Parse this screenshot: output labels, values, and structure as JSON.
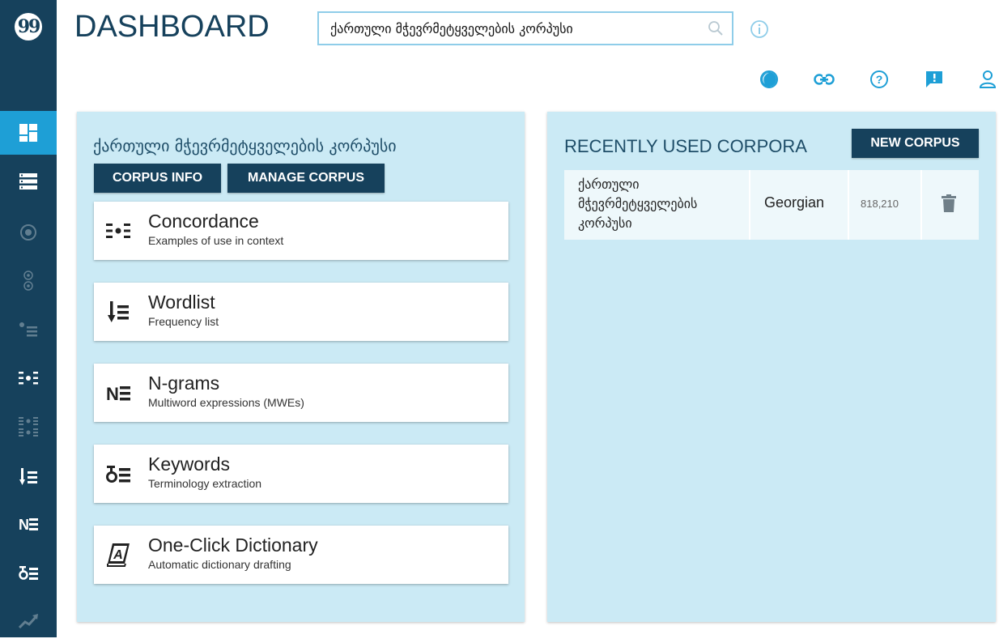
{
  "header": {
    "title": "DASHBOARD",
    "search": {
      "value": "ქართული მჭევრმეტყველების კორპუსი",
      "placeholder": ""
    }
  },
  "sidebar": {
    "items": [
      {
        "icon": "dashboard-icon",
        "active": true
      },
      {
        "icon": "corpus-list-icon"
      },
      {
        "icon": "target-icon",
        "dim": true
      },
      {
        "icon": "two-circles-icon",
        "dim": true
      },
      {
        "icon": "dot-list-icon",
        "dim": true
      },
      {
        "icon": "concordance-icon"
      },
      {
        "icon": "parallel-concordance-icon",
        "dim": true
      },
      {
        "icon": "wordlist-icon"
      },
      {
        "icon": "ngrams-icon"
      },
      {
        "icon": "keywords-icon"
      },
      {
        "icon": "trends-icon",
        "dim": true
      }
    ]
  },
  "left_panel": {
    "corpus_name": "ქართული მჭევრმეტყველების კორპუსი",
    "corpus_info_label": "CORPUS INFO",
    "manage_corpus_label": "MANAGE CORPUS",
    "tools": [
      {
        "title": "Concordance",
        "subtitle": "Examples of use in context",
        "icon": "concordance-icon"
      },
      {
        "title": "Wordlist",
        "subtitle": "Frequency list",
        "icon": "wordlist-icon"
      },
      {
        "title": "N-grams",
        "subtitle": "Multiword expressions (MWEs)",
        "icon": "ngrams-icon"
      },
      {
        "title": "Keywords",
        "subtitle": "Terminology extraction",
        "icon": "keywords-icon"
      },
      {
        "title": "One-Click Dictionary",
        "subtitle": "Automatic dictionary drafting",
        "icon": "dictionary-icon"
      }
    ]
  },
  "right_panel": {
    "title": "RECENTLY USED CORPORA",
    "new_corpus_label": "NEW CORPUS",
    "corpora": [
      {
        "name": "ქართული მჭევრმეტყველების კორპუსი",
        "language": "Georgian",
        "size": "818,210"
      }
    ]
  },
  "colors": {
    "sidebar": "#16415c",
    "accent": "#1e9fd6",
    "panel": "#cbeaf5",
    "button": "#16415c"
  }
}
